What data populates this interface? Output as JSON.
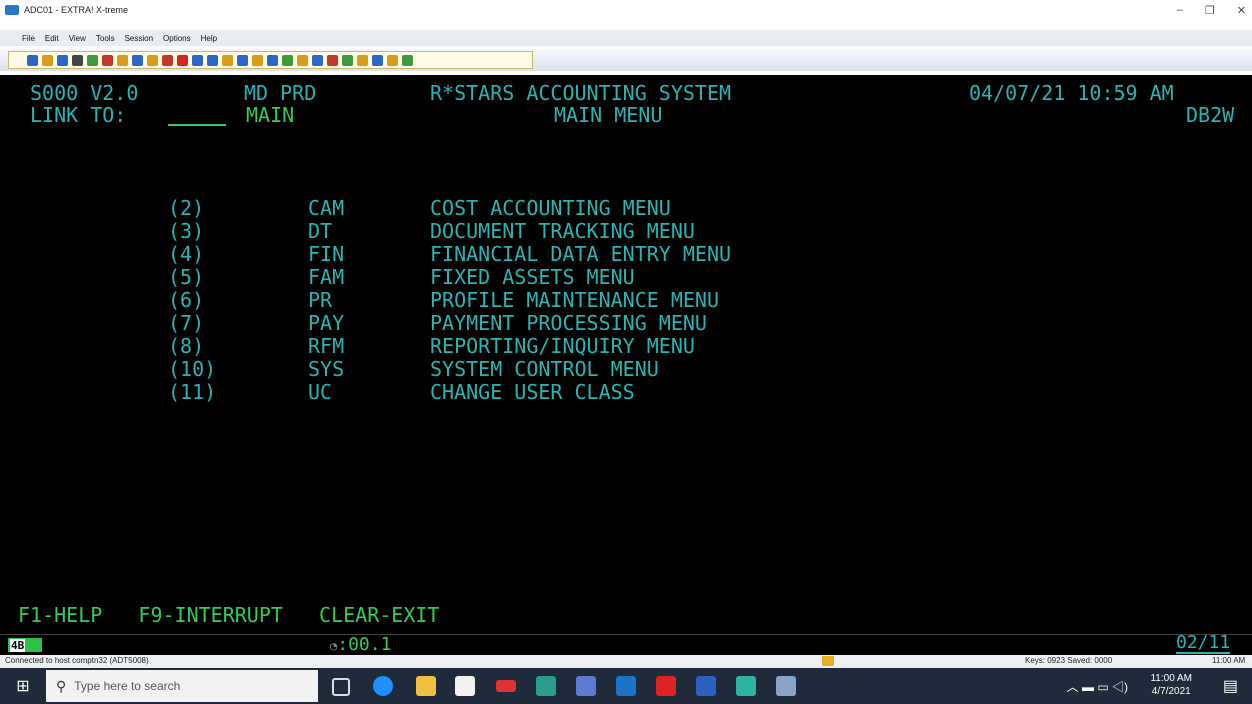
{
  "window": {
    "title": "ADC01 - EXTRA! X-treme",
    "min": "–",
    "max": "❐",
    "close": "✕"
  },
  "menu": [
    "File",
    "Edit",
    "View",
    "Tools",
    "Session",
    "Options",
    "Help"
  ],
  "toolbar": {
    "colors": [
      "#2d66c9",
      "#d89c1a",
      "#2d66c9",
      "#444",
      "#3d9a3d",
      "#c0392b",
      "#d89c1a",
      "#2d66c9",
      "#d89c1a",
      "#c0392b",
      "#d22",
      "#2d66c9",
      "#2d66c9",
      "#d89c1a",
      "#2d66c9",
      "#d89c1a",
      "#2d66c9",
      "#3d9a3d",
      "#d89c1a",
      "#2d66c9",
      "#c0392b",
      "#3d9a3d",
      "#d89c1a",
      "#2d66c9",
      "#d89c1a",
      "#3d9a3d"
    ]
  },
  "screen": {
    "screen_id": "S000 V2.0",
    "region": "MD PRD",
    "system_title": "R*STARS ACCOUNTING SYSTEM",
    "datetime": "04/07/21 10:59 AM",
    "link_label": "LINK TO:",
    "link_value": "MAIN",
    "menu_title": "MAIN MENU",
    "db": "DB2W",
    "items": [
      {
        "num": "(2)",
        "code": "CAM",
        "desc": "COST ACCOUNTING MENU"
      },
      {
        "num": "(3)",
        "code": "DT",
        "desc": "DOCUMENT TRACKING MENU"
      },
      {
        "num": "(4)",
        "code": "FIN",
        "desc": "FINANCIAL DATA ENTRY MENU"
      },
      {
        "num": "(5)",
        "code": "FAM",
        "desc": "FIXED ASSETS MENU"
      },
      {
        "num": "(6)",
        "code": "PR",
        "desc": "PROFILE MAINTENANCE MENU"
      },
      {
        "num": "(7)",
        "code": "PAY",
        "desc": "PAYMENT PROCESSING MENU"
      },
      {
        "num": "(8)",
        "code": "RFM",
        "desc": "REPORTING/INQUIRY MENU"
      },
      {
        "num": "(10)",
        "code": "SYS",
        "desc": "SYSTEM CONTROL MENU"
      },
      {
        "num": "(11)",
        "code": "UC",
        "desc": "CHANGE USER CLASS"
      }
    ],
    "fkeys": "F1-HELP   F9-INTERRUPT   CLEAR-EXIT"
  },
  "oia": {
    "indicator": "4B",
    "timer": ":00.1",
    "cursor_pos": "02/11"
  },
  "statusbar": {
    "connection": "Connected to host comptn32 (ADT5008)",
    "keys": "Keys: 0923  Saved: 0000",
    "time": "11:00 AM"
  },
  "taskbar": {
    "search_placeholder": "Type here to search",
    "clock_time": "11:00 AM",
    "clock_date": "4/7/2021"
  }
}
